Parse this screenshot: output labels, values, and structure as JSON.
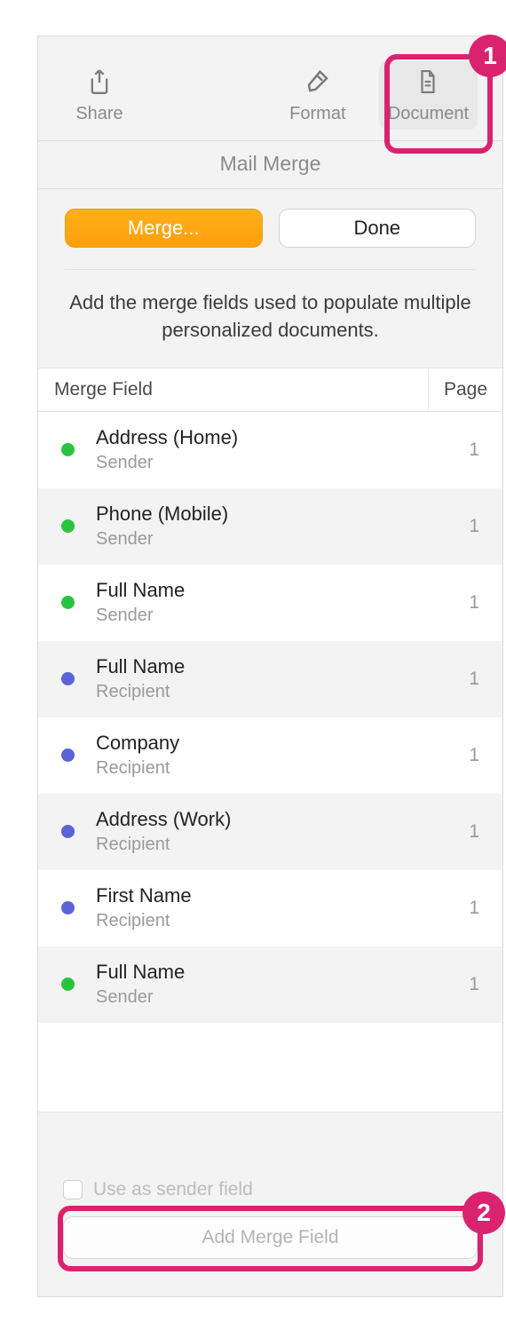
{
  "toolbar": {
    "share_label": "Share",
    "format_label": "Format",
    "document_label": "Document"
  },
  "section_title": "Mail Merge",
  "buttons": {
    "merge_label": "Merge...",
    "done_label": "Done"
  },
  "help_text": "Add the merge fields used to populate multiple personalized documents.",
  "columns": {
    "field_header": "Merge Field",
    "page_header": "Page"
  },
  "fields": [
    {
      "name": "Address (Home)",
      "role": "Sender",
      "color": "green",
      "page": "1"
    },
    {
      "name": "Phone (Mobile)",
      "role": "Sender",
      "color": "green",
      "page": "1"
    },
    {
      "name": "Full Name",
      "role": "Sender",
      "color": "green",
      "page": "1"
    },
    {
      "name": "Full Name",
      "role": "Recipient",
      "color": "blue",
      "page": "1"
    },
    {
      "name": "Company",
      "role": "Recipient",
      "color": "blue",
      "page": "1"
    },
    {
      "name": "Address (Work)",
      "role": "Recipient",
      "color": "blue",
      "page": "1"
    },
    {
      "name": "First Name",
      "role": "Recipient",
      "color": "blue",
      "page": "1"
    },
    {
      "name": "Full Name",
      "role": "Sender",
      "color": "green",
      "page": "1"
    }
  ],
  "footer": {
    "sender_checkbox_label": "Use as sender field",
    "add_button_label": "Add Merge Field"
  },
  "callouts": {
    "one": "1",
    "two": "2"
  }
}
